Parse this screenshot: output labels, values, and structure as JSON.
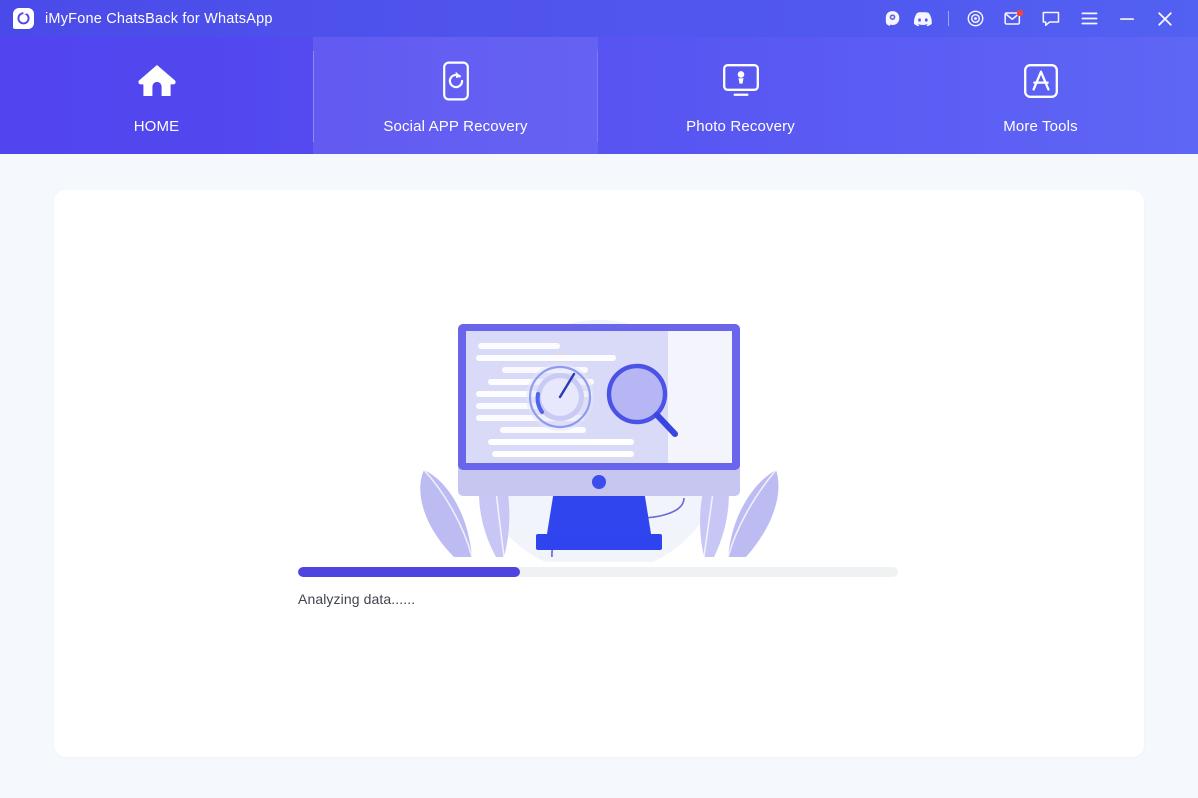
{
  "window": {
    "title": "iMyFone ChatsBack for WhatsApp",
    "logo_icon": "chatsback-c-logo",
    "controls": [
      {
        "name": "support-headset-icon",
        "label": "Support"
      },
      {
        "name": "discord-icon",
        "label": "Discord"
      },
      {
        "name": "target-settings-icon",
        "label": "Settings"
      },
      {
        "name": "mail-envelope-icon",
        "label": "Messages",
        "badge": true
      },
      {
        "name": "feedback-chat-icon",
        "label": "Feedback"
      },
      {
        "name": "hamburger-menu-icon",
        "label": "Menu"
      },
      {
        "name": "minimize-icon",
        "label": "Minimize"
      },
      {
        "name": "close-icon",
        "label": "Close"
      }
    ]
  },
  "nav": {
    "tabs": [
      {
        "label": "HOME",
        "icon": "home-icon",
        "active": false
      },
      {
        "label": "Social APP Recovery",
        "icon": "phone-refresh-icon",
        "active": true
      },
      {
        "label": "Photo Recovery",
        "icon": "monitor-photo-icon",
        "active": false
      },
      {
        "label": "More Tools",
        "icon": "app-store-icon",
        "active": false
      }
    ]
  },
  "main": {
    "illustration": "monitor-analyzing-illustration",
    "progress": {
      "percent": 37,
      "status_text": "Analyzing data......"
    }
  },
  "colors": {
    "titlebar_start": "#4a4ae8",
    "titlebar_end": "#5261f2",
    "nav_start": "#5245f0",
    "nav_end": "#5e66f5",
    "accent": "#4f44e0",
    "track": "#f0f1f3",
    "page_bg": "#f5f9fd",
    "card_bg": "#ffffff",
    "status_text": "#40444d",
    "badge": "#f8443c"
  }
}
